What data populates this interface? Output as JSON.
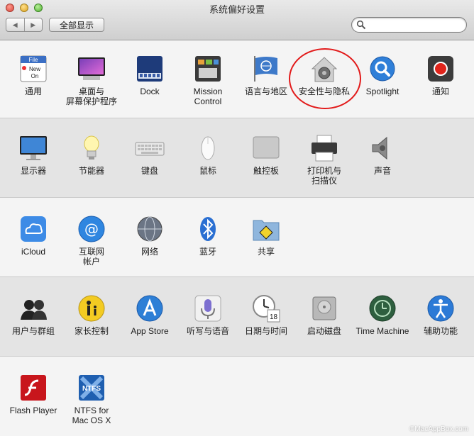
{
  "window": {
    "title": "系统偏好设置"
  },
  "toolbar": {
    "back_glyph": "◀",
    "forward_glyph": "▶",
    "show_all_label": "全部显示"
  },
  "search": {
    "value": "",
    "placeholder": ""
  },
  "rows": [
    {
      "items": [
        {
          "label": "通用",
          "icon": "general-icon"
        },
        {
          "label": "桌面与\n屏幕保护程序",
          "icon": "desktop-screensaver-icon"
        },
        {
          "label": "Dock",
          "icon": "dock-icon"
        },
        {
          "label": "Mission\nControl",
          "icon": "mission-control-icon"
        },
        {
          "label": "语言与地区",
          "icon": "language-region-icon"
        },
        {
          "label": "安全性与隐私",
          "icon": "security-privacy-icon"
        },
        {
          "label": "Spotlight",
          "icon": "spotlight-icon"
        },
        {
          "label": "通知",
          "icon": "notifications-icon"
        }
      ]
    },
    {
      "items": [
        {
          "label": "显示器",
          "icon": "displays-icon"
        },
        {
          "label": "节能器",
          "icon": "energy-saver-icon"
        },
        {
          "label": "键盘",
          "icon": "keyboard-icon"
        },
        {
          "label": "鼠标",
          "icon": "mouse-icon"
        },
        {
          "label": "触控板",
          "icon": "trackpad-icon"
        },
        {
          "label": "打印机与\n扫描仪",
          "icon": "printers-scanners-icon"
        },
        {
          "label": "声音",
          "icon": "sound-icon"
        }
      ]
    },
    {
      "items": [
        {
          "label": "iCloud",
          "icon": "icloud-icon"
        },
        {
          "label": "互联网\n帐户",
          "icon": "internet-accounts-icon"
        },
        {
          "label": "网络",
          "icon": "network-icon"
        },
        {
          "label": "蓝牙",
          "icon": "bluetooth-icon"
        },
        {
          "label": "共享",
          "icon": "sharing-icon"
        }
      ]
    },
    {
      "items": [
        {
          "label": "用户与群组",
          "icon": "users-groups-icon"
        },
        {
          "label": "家长控制",
          "icon": "parental-controls-icon"
        },
        {
          "label": "App Store",
          "icon": "app-store-icon"
        },
        {
          "label": "听写与语音",
          "icon": "dictation-speech-icon"
        },
        {
          "label": "日期与时间",
          "icon": "date-time-icon"
        },
        {
          "label": "启动磁盘",
          "icon": "startup-disk-icon"
        },
        {
          "label": "Time Machine",
          "icon": "time-machine-icon"
        },
        {
          "label": "辅助功能",
          "icon": "accessibility-icon"
        }
      ]
    },
    {
      "items": [
        {
          "label": "Flash Player",
          "icon": "flash-player-icon"
        },
        {
          "label": "NTFS for\nMac OS X",
          "icon": "ntfs-icon"
        }
      ]
    }
  ],
  "icon_text": {
    "general_file": "File",
    "general_new": "New",
    "general_on": "On",
    "calendar_day": "18",
    "ntfs": "NTFS"
  },
  "watermark": "©MacAppBox.com",
  "colors": {
    "highlight": "#e21a1a",
    "spotlight_blue": "#2f7fd8",
    "notifications_red": "#e0241b"
  }
}
